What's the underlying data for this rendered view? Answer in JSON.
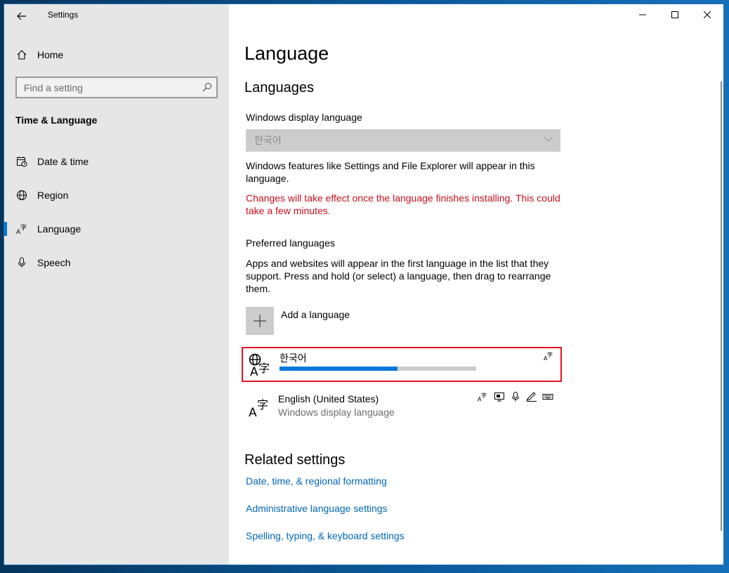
{
  "window": {
    "app_title": "Settings",
    "controls": [
      "minimize-icon",
      "maximize-icon",
      "close-icon"
    ]
  },
  "sidebar": {
    "home_label": "Home",
    "search_placeholder": "Find a setting",
    "section_title": "Time & Language",
    "items": [
      {
        "label": "Date & time",
        "icon": "calendar-clock-icon",
        "selected": false
      },
      {
        "label": "Region",
        "icon": "globe-icon",
        "selected": false
      },
      {
        "label": "Language",
        "icon": "language-icon",
        "selected": true
      },
      {
        "label": "Speech",
        "icon": "microphone-icon",
        "selected": false
      }
    ]
  },
  "main": {
    "title": "Language",
    "languages_heading": "Languages",
    "display_language": {
      "label": "Windows display language",
      "value": "한국어",
      "description": "Windows features like Settings and File Explorer will appear in this language.",
      "warning": "Changes will take effect once the language finishes installing. This could take a few minutes."
    },
    "preferred": {
      "label": "Preferred languages",
      "description": "Apps and websites will appear in the first language in the list that they support. Press and hold (or select) a language, then drag to rearrange them.",
      "add_label": "Add a language",
      "languages": [
        {
          "name": "한국어",
          "progress": 0.6,
          "selected": true,
          "features": [
            "language-pack-icon"
          ]
        },
        {
          "name": "English (United States)",
          "subtitle": "Windows display language",
          "selected": false,
          "features": [
            "language-pack-icon",
            "display-icon",
            "speech-icon",
            "handwriting-icon",
            "keyboard-icon"
          ]
        }
      ]
    },
    "related": {
      "heading": "Related settings",
      "links": [
        "Date, time, & regional formatting",
        "Administrative language settings",
        "Spelling, typing, & keyboard settings"
      ]
    }
  },
  "colors": {
    "accent": "#0078d7",
    "link": "#0067b8",
    "warning": "#c50f1f",
    "selection_border": "#e81123"
  }
}
